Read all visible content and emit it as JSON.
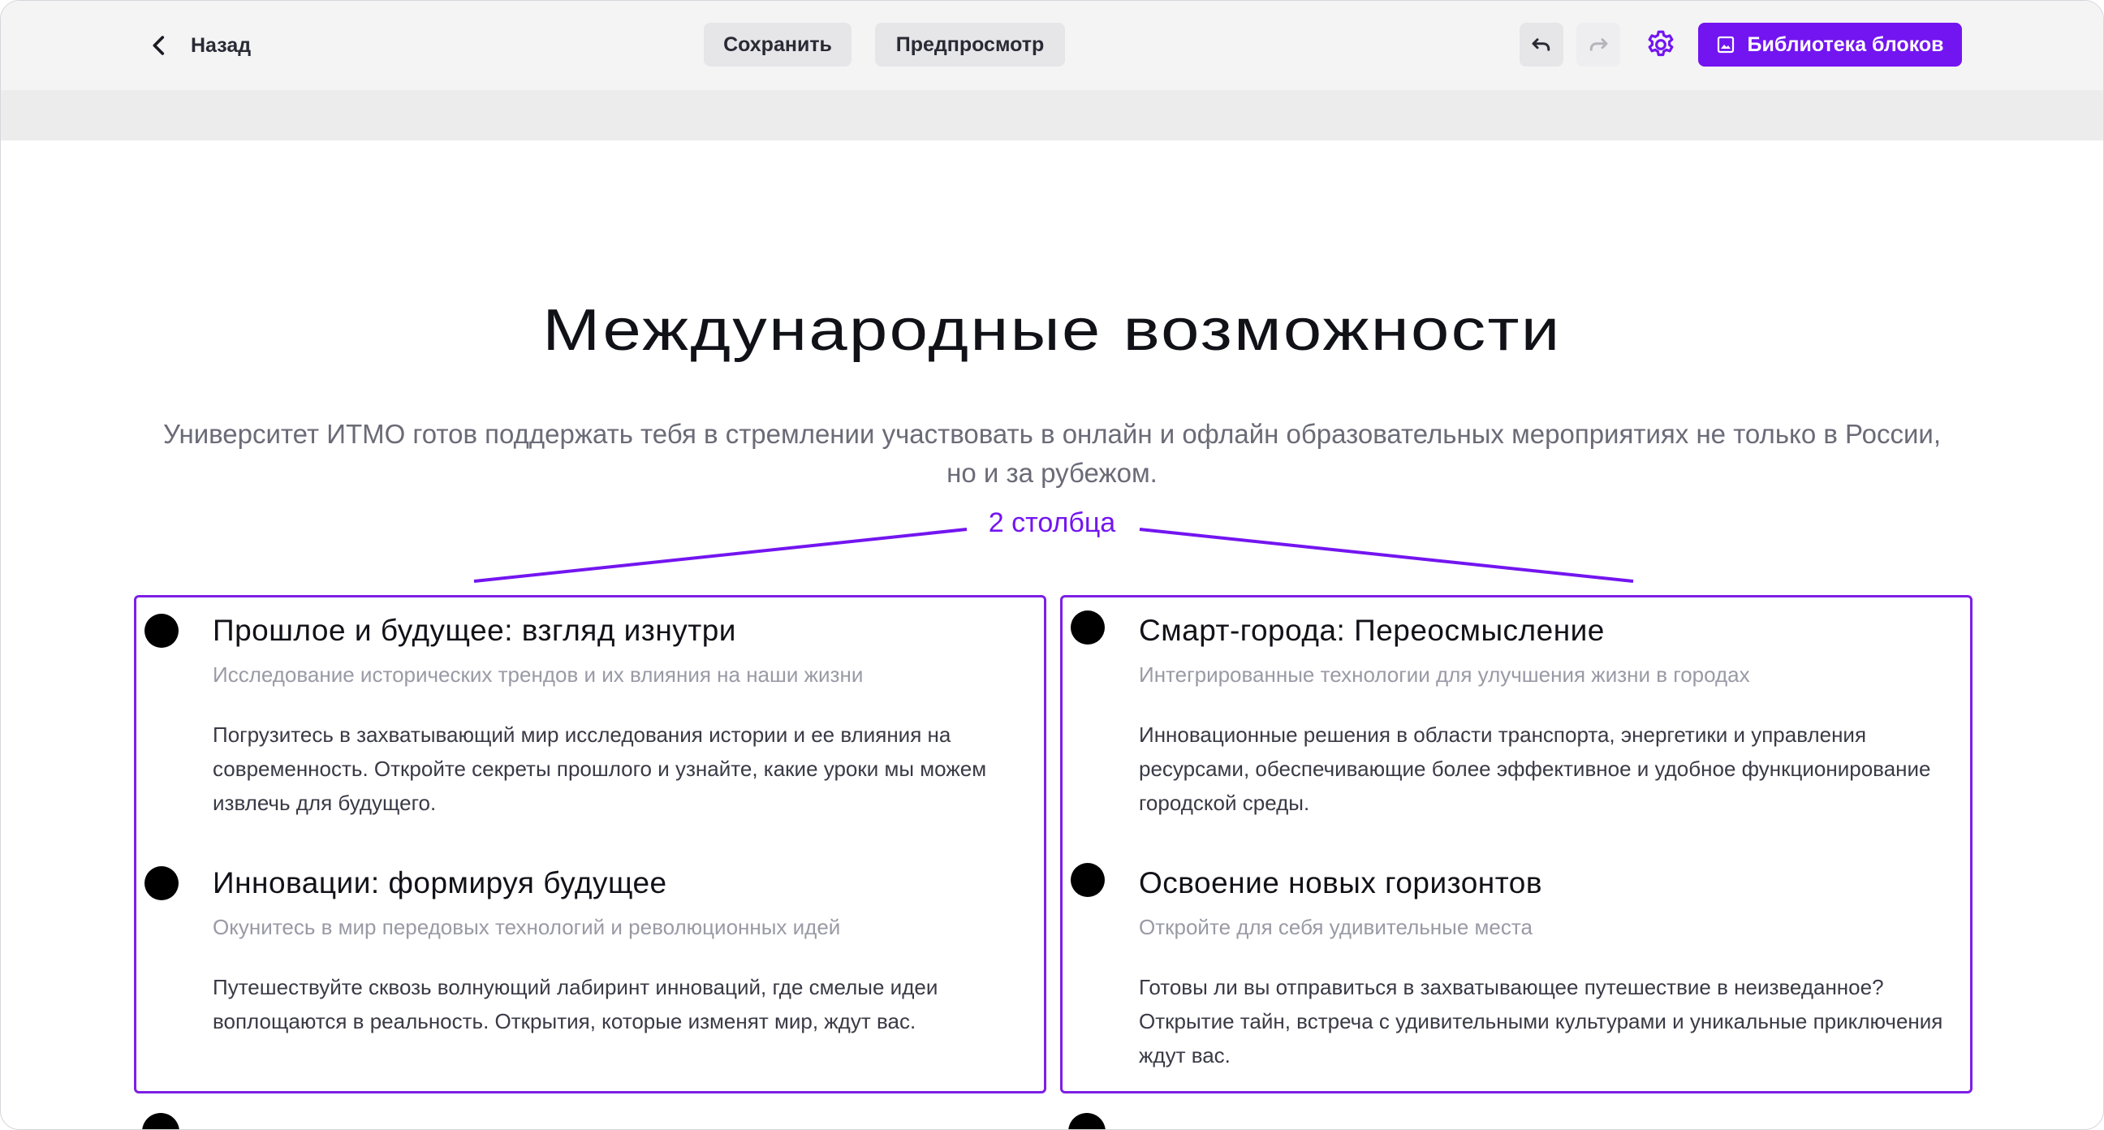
{
  "toolbar": {
    "back_label": "Назад",
    "save_label": "Сохранить",
    "preview_label": "Предпросмотр",
    "library_label": "Библиотека блоков",
    "icons": {
      "back": "chevron-left-icon",
      "undo": "undo-icon",
      "redo": "redo-icon",
      "settings": "gear-icon",
      "library": "image-icon"
    },
    "accent_color": "#7315f0"
  },
  "section": {
    "title": "Международные возможности",
    "lead": "Университет ИТМО готов поддержать тебя в стремлении участвовать в онлайн и офлайн образовательных мероприятиях не только в России, но и за рубежом."
  },
  "annotation": {
    "label": "2 столбца",
    "color": "#7315f0"
  },
  "columns": [
    {
      "items": [
        {
          "title": "Прошлое и будущее: взгляд изнутри",
          "subtitle": "Исследование исторических трендов и их влияния на наши жизни",
          "text": "Погрузитесь в захватывающий мир исследования истории и ее влияния на современность. Откройте секреты прошлого и узнайте, какие уроки мы можем извлечь для будущего."
        },
        {
          "title": "Инновации: формируя будущее",
          "subtitle": "Окунитесь в мир передовых технологий и революционных идей",
          "text": "Путешествуйте сквозь волнующий лабиринт инноваций, где смелые идеи воплощаются в реальность. Открытия, которые изменят мир, ждут вас."
        }
      ]
    },
    {
      "items": [
        {
          "title": "Смарт-города: Переосмысление",
          "subtitle": "Интегрированные технологии для улучшения жизни в городах",
          "text": "Инновационные решения в области транспорта, энергетики и управления ресурсами, обеспечивающие более эффективное и удобное функционирование городской среды."
        },
        {
          "title": "Освоение новых горизонтов",
          "subtitle": "Откройте для себя удивительные места",
          "text": "Готовы ли вы отправиться в захватывающее путешествие в неизведанное? Открытие тайн, встреча с удивительными культурами и уникальные приключения ждут вас."
        }
      ]
    }
  ]
}
